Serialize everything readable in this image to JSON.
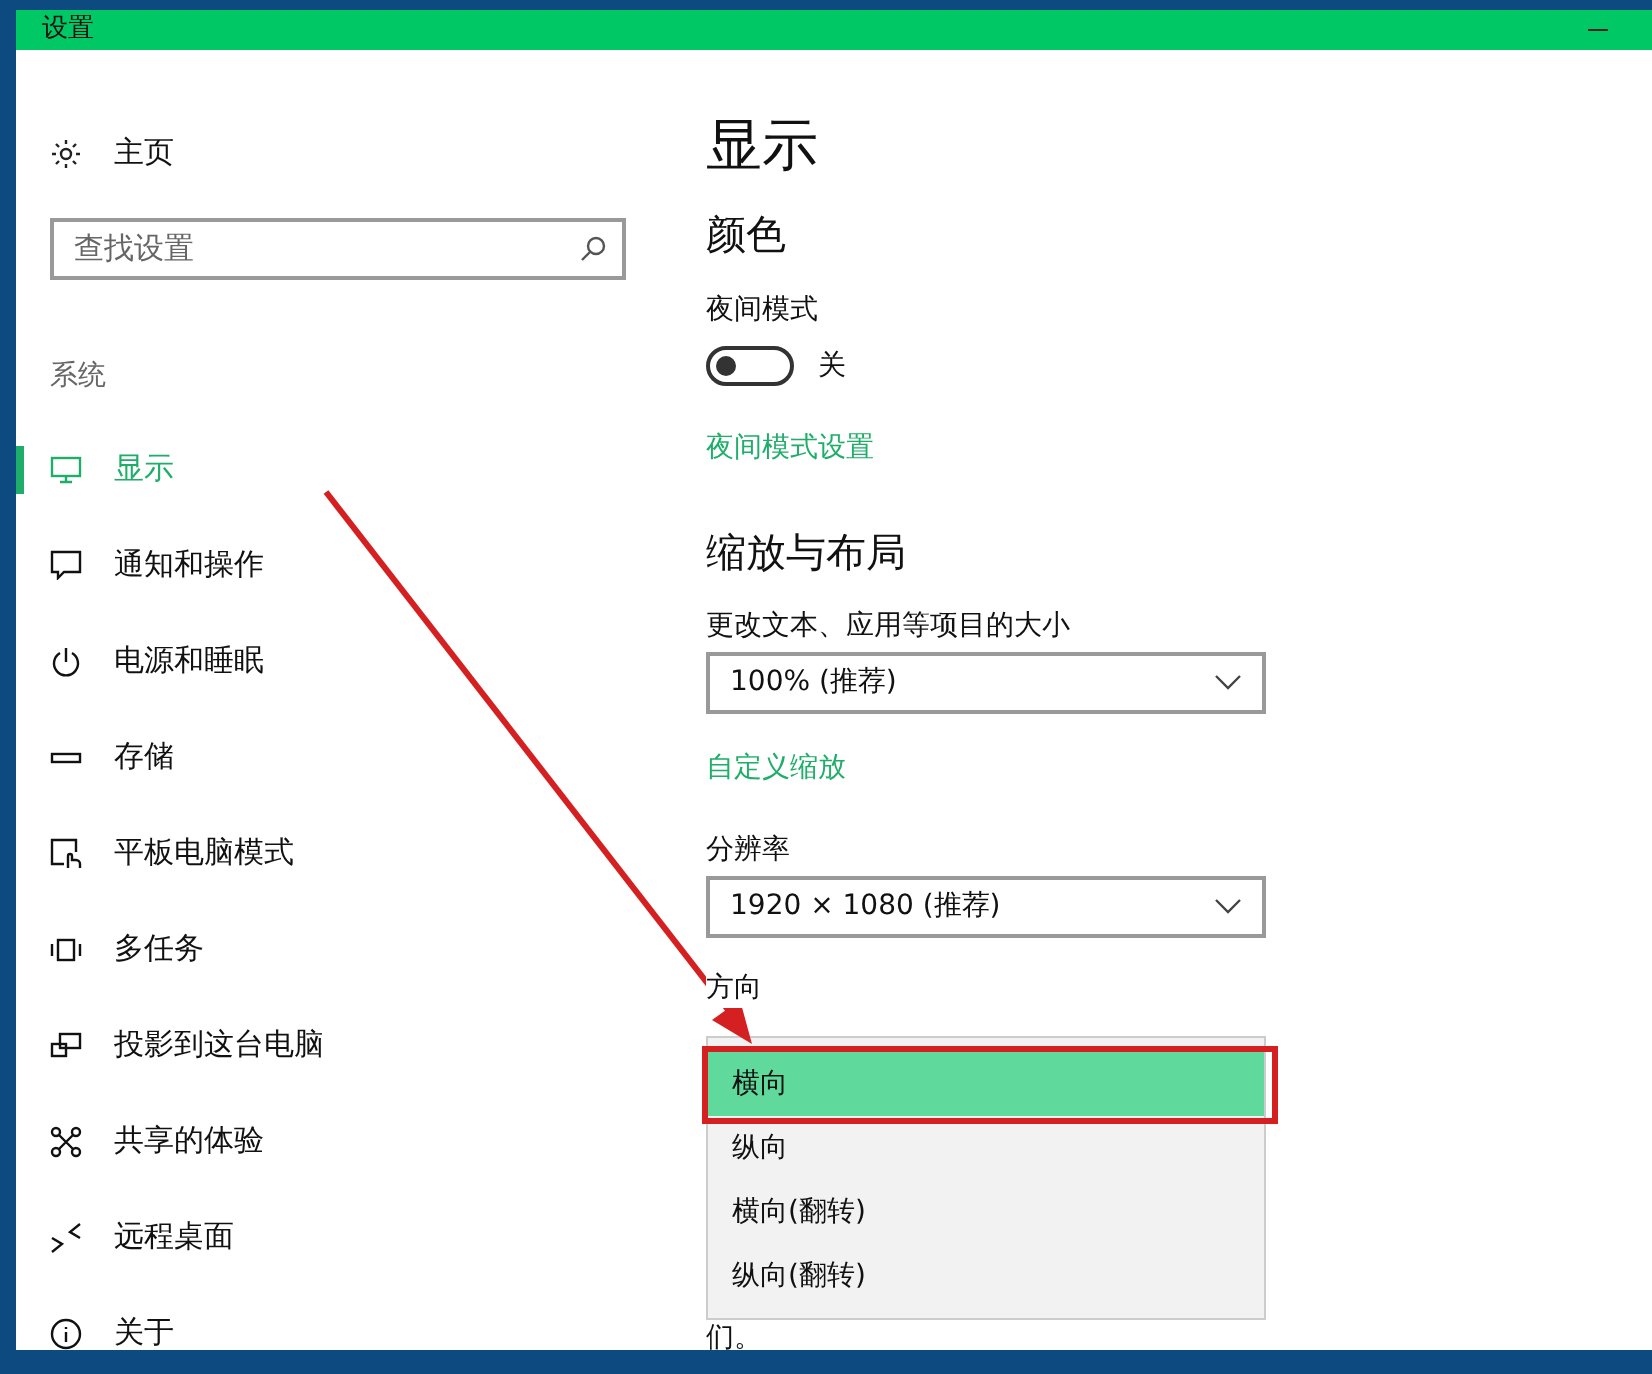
{
  "window": {
    "title": "设置"
  },
  "sidebar": {
    "home": "主页",
    "search": {
      "placeholder": "查找设置"
    },
    "section": "系统",
    "items": [
      {
        "label": "显示",
        "selected": true
      },
      {
        "label": "通知和操作",
        "selected": false
      },
      {
        "label": "电源和睡眠",
        "selected": false
      },
      {
        "label": "存储",
        "selected": false
      },
      {
        "label": "平板电脑模式",
        "selected": false
      },
      {
        "label": "多任务",
        "selected": false
      },
      {
        "label": "投影到这台电脑",
        "selected": false
      },
      {
        "label": "共享的体验",
        "selected": false
      },
      {
        "label": "远程桌面",
        "selected": false
      },
      {
        "label": "关于",
        "selected": false
      }
    ]
  },
  "content": {
    "title": "显示",
    "color_heading": "颜色",
    "night_mode": {
      "label": "夜间模式",
      "on": false,
      "state_text": "关"
    },
    "night_mode_link": "夜间模式设置",
    "scale_heading": "缩放与布局",
    "scale_label": "更改文本、应用等项目的大小",
    "scale_value": "100% (推荐)",
    "custom_scale_link": "自定义缩放",
    "resolution_label": "分辨率",
    "resolution_value": "1920 × 1080 (推荐)",
    "orientation_label": "方向",
    "orientation_options": [
      {
        "label": "横向",
        "selected": true
      },
      {
        "label": "纵向",
        "selected": false
      },
      {
        "label": "横向(翻转)",
        "selected": false
      },
      {
        "label": "纵向(翻转)",
        "selected": false
      }
    ],
    "trailing_text": "们。"
  }
}
